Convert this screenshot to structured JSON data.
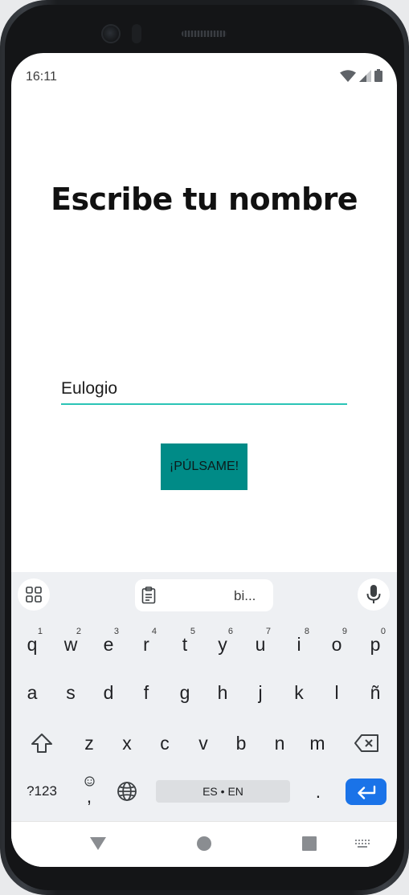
{
  "status_bar": {
    "time": "16:11"
  },
  "main": {
    "title": "Escribe tu nombre",
    "name_input_value": "Eulogio",
    "button_label": "¡PÚLSAME!"
  },
  "keyboard": {
    "suggestion": "bi...",
    "row1": [
      {
        "key": "q",
        "hint": "1"
      },
      {
        "key": "w",
        "hint": "2"
      },
      {
        "key": "e",
        "hint": "3"
      },
      {
        "key": "r",
        "hint": "4"
      },
      {
        "key": "t",
        "hint": "5"
      },
      {
        "key": "y",
        "hint": "6"
      },
      {
        "key": "u",
        "hint": "7"
      },
      {
        "key": "i",
        "hint": "8"
      },
      {
        "key": "o",
        "hint": "9"
      },
      {
        "key": "p",
        "hint": "0"
      }
    ],
    "row2": [
      "a",
      "s",
      "d",
      "f",
      "g",
      "h",
      "j",
      "k",
      "l",
      "ñ"
    ],
    "row3": [
      "z",
      "x",
      "c",
      "v",
      "b",
      "n",
      "m"
    ],
    "symbols_label": "?123",
    "comma_label": ",",
    "space_label": "ES • EN",
    "period_label": "."
  },
  "colors": {
    "accent": "#2bc4b6",
    "button": "#008b87",
    "enter_key": "#1a73e8"
  },
  "icons": {
    "status": [
      "wifi-icon",
      "cellular-signal-icon",
      "battery-icon"
    ],
    "keyboard_toolbar": [
      "apps-grid-icon",
      "clipboard-icon",
      "microphone-icon"
    ],
    "keyboard_keys": [
      "shift-icon",
      "backspace-icon",
      "emoji-icon",
      "globe-icon",
      "enter-icon"
    ],
    "navigation": [
      "back-icon",
      "home-icon",
      "recents-icon",
      "keyboard-switch-icon"
    ]
  }
}
